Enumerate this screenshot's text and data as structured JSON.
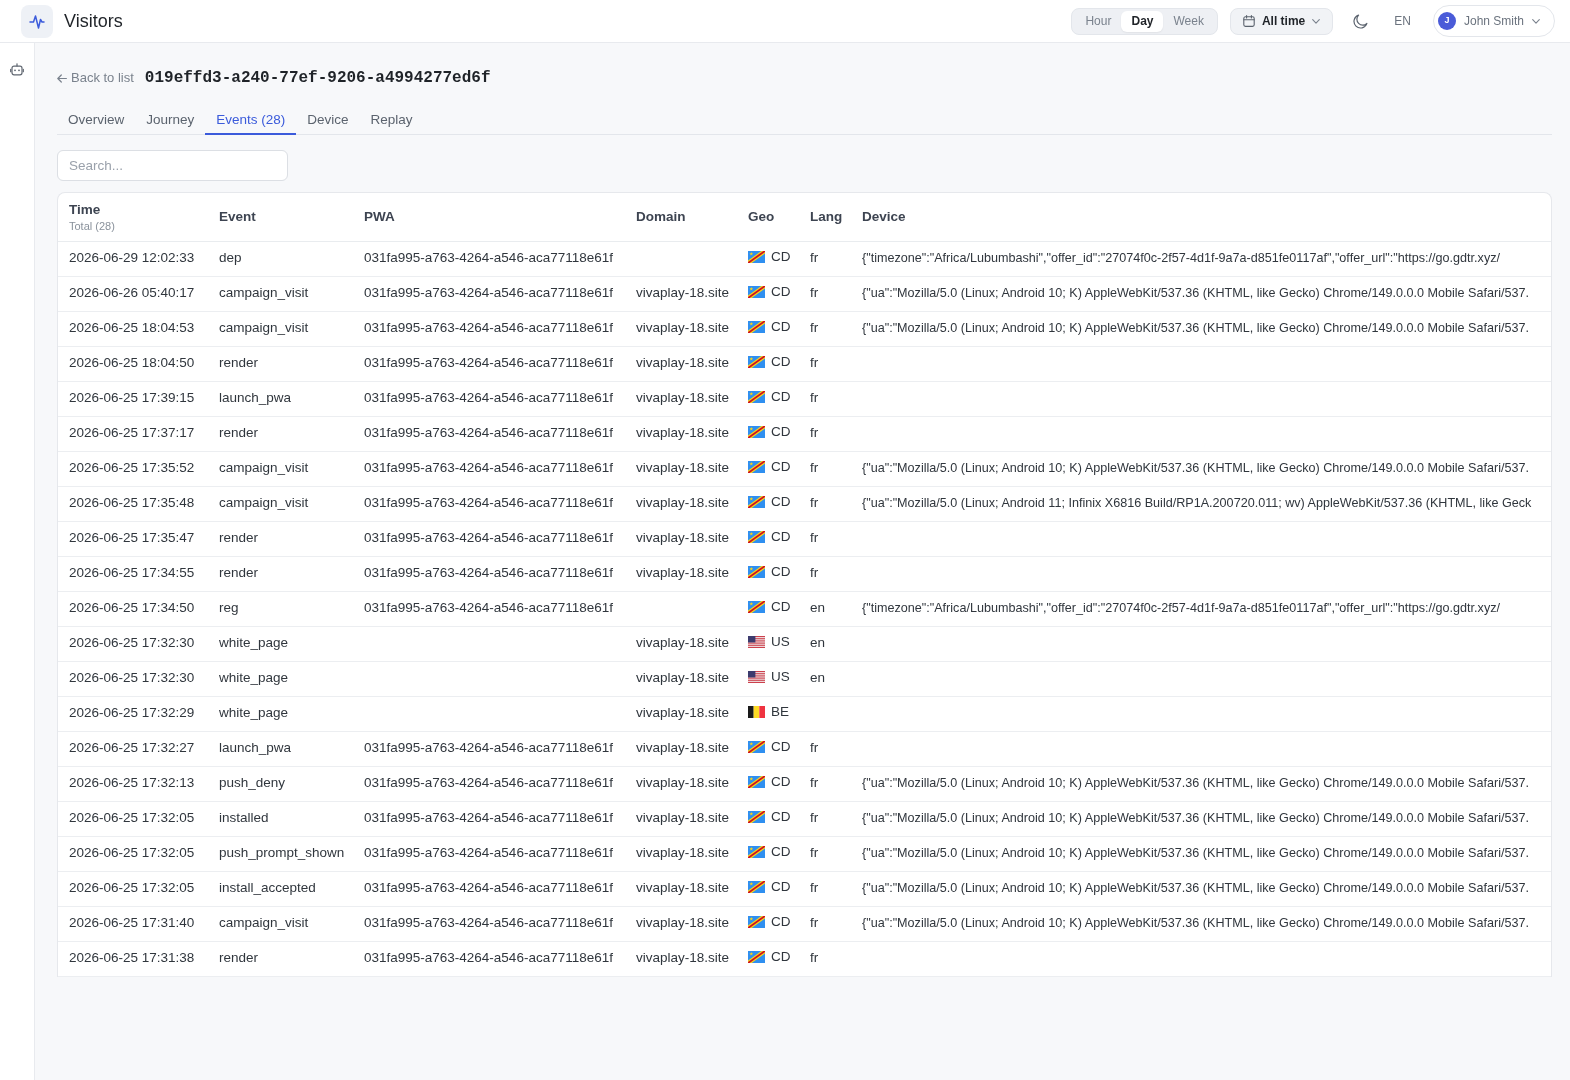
{
  "header": {
    "title": "Visitors",
    "periods": [
      {
        "label": "Hour",
        "selected": false
      },
      {
        "label": "Day",
        "selected": true
      },
      {
        "label": "Week",
        "selected": false
      }
    ],
    "date_range": "All time",
    "language": "EN",
    "user": {
      "initial": "J",
      "name": "John Smith"
    }
  },
  "visitor": {
    "back_link": "Back to list",
    "id": "019effd3-a240-77ef-9206-a4994277ed6f"
  },
  "tabs": [
    {
      "label": "Overview",
      "selected": false
    },
    {
      "label": "Journey",
      "selected": false
    },
    {
      "label": "Events (28)",
      "selected": true
    },
    {
      "label": "Device",
      "selected": false
    },
    {
      "label": "Replay",
      "selected": false
    }
  ],
  "search": {
    "placeholder": "Search..."
  },
  "table": {
    "columns": [
      "Time",
      "Event",
      "PWA",
      "Domain",
      "Geo",
      "Lang",
      "Device"
    ],
    "total": "Total (28)",
    "rows": [
      {
        "time": "2026-06-29 12:02:33",
        "event": "dep",
        "pwa": "031fa995-a763-4264-a546-aca77118e61f",
        "geo": {
          "kind": "cd",
          "code": "CD"
        },
        "lang": "fr",
        "device": "{\"timezone\":\"Africa/Lubumbashi\",\"offer_id\":\"27074f0c-2f57-4d1f-9a7a-d851fe0117af\",\"offer_url\":\"https://go.gdtr.xyz/"
      },
      {
        "time": "2026-06-26 05:40:17",
        "event": "campaign_visit",
        "pwa": "031fa995-a763-4264-a546-aca77118e61f",
        "domain": "vivaplay-18.site",
        "geo": {
          "kind": "cd",
          "code": "CD"
        },
        "lang": "fr",
        "device": "{\"ua\":\"Mozilla/5.0 (Linux; Android 10; K) AppleWebKit/537.36 (KHTML, like Gecko) Chrome/149.0.0.0 Mobile Safari/537."
      },
      {
        "time": "2026-06-25 18:04:53",
        "event": "campaign_visit",
        "pwa": "031fa995-a763-4264-a546-aca77118e61f",
        "domain": "vivaplay-18.site",
        "geo": {
          "kind": "cd",
          "code": "CD"
        },
        "lang": "fr",
        "device": "{\"ua\":\"Mozilla/5.0 (Linux; Android 10; K) AppleWebKit/537.36 (KHTML, like Gecko) Chrome/149.0.0.0 Mobile Safari/537."
      },
      {
        "time": "2026-06-25 18:04:50",
        "event": "render",
        "pwa": "031fa995-a763-4264-a546-aca77118e61f",
        "domain": "vivaplay-18.site",
        "geo": {
          "kind": "cd",
          "code": "CD"
        },
        "lang": "fr"
      },
      {
        "time": "2026-06-25 17:39:15",
        "event": "launch_pwa",
        "pwa": "031fa995-a763-4264-a546-aca77118e61f",
        "domain": "vivaplay-18.site",
        "geo": {
          "kind": "cd",
          "code": "CD"
        },
        "lang": "fr"
      },
      {
        "time": "2026-06-25 17:37:17",
        "event": "render",
        "pwa": "031fa995-a763-4264-a546-aca77118e61f",
        "domain": "vivaplay-18.site",
        "geo": {
          "kind": "cd",
          "code": "CD"
        },
        "lang": "fr"
      },
      {
        "time": "2026-06-25 17:35:52",
        "event": "campaign_visit",
        "pwa": "031fa995-a763-4264-a546-aca77118e61f",
        "domain": "vivaplay-18.site",
        "geo": {
          "kind": "cd",
          "code": "CD"
        },
        "lang": "fr",
        "device": "{\"ua\":\"Mozilla/5.0 (Linux; Android 10; K) AppleWebKit/537.36 (KHTML, like Gecko) Chrome/149.0.0.0 Mobile Safari/537."
      },
      {
        "time": "2026-06-25 17:35:48",
        "event": "campaign_visit",
        "pwa": "031fa995-a763-4264-a546-aca77118e61f",
        "domain": "vivaplay-18.site",
        "geo": {
          "kind": "cd",
          "code": "CD"
        },
        "lang": "fr",
        "device": "{\"ua\":\"Mozilla/5.0 (Linux; Android 11; Infinix X6816 Build/RP1A.200720.011; wv) AppleWebKit/537.36 (KHTML, like Geck"
      },
      {
        "time": "2026-06-25 17:35:47",
        "event": "render",
        "pwa": "031fa995-a763-4264-a546-aca77118e61f",
        "domain": "vivaplay-18.site",
        "geo": {
          "kind": "cd",
          "code": "CD"
        },
        "lang": "fr"
      },
      {
        "time": "2026-06-25 17:34:55",
        "event": "render",
        "pwa": "031fa995-a763-4264-a546-aca77118e61f",
        "domain": "vivaplay-18.site",
        "geo": {
          "kind": "cd",
          "code": "CD"
        },
        "lang": "fr"
      },
      {
        "time": "2026-06-25 17:34:50",
        "event": "reg",
        "pwa": "031fa995-a763-4264-a546-aca77118e61f",
        "geo": {
          "kind": "cd",
          "code": "CD"
        },
        "lang": "en",
        "device": "{\"timezone\":\"Africa/Lubumbashi\",\"offer_id\":\"27074f0c-2f57-4d1f-9a7a-d851fe0117af\",\"offer_url\":\"https://go.gdtr.xyz/"
      },
      {
        "time": "2026-06-25 17:32:30",
        "event": "white_page",
        "domain": "vivaplay-18.site",
        "geo": {
          "kind": "us",
          "code": "US"
        },
        "lang": "en"
      },
      {
        "time": "2026-06-25 17:32:30",
        "event": "white_page",
        "domain": "vivaplay-18.site",
        "geo": {
          "kind": "us",
          "code": "US"
        },
        "lang": "en"
      },
      {
        "time": "2026-06-25 17:32:29",
        "event": "white_page",
        "domain": "vivaplay-18.site",
        "geo": {
          "kind": "be",
          "code": "BE"
        }
      },
      {
        "time": "2026-06-25 17:32:27",
        "event": "launch_pwa",
        "pwa": "031fa995-a763-4264-a546-aca77118e61f",
        "domain": "vivaplay-18.site",
        "geo": {
          "kind": "cd",
          "code": "CD"
        },
        "lang": "fr"
      },
      {
        "time": "2026-06-25 17:32:13",
        "event": "push_deny",
        "pwa": "031fa995-a763-4264-a546-aca77118e61f",
        "domain": "vivaplay-18.site",
        "geo": {
          "kind": "cd",
          "code": "CD"
        },
        "lang": "fr",
        "device": "{\"ua\":\"Mozilla/5.0 (Linux; Android 10; K) AppleWebKit/537.36 (KHTML, like Gecko) Chrome/149.0.0.0 Mobile Safari/537."
      },
      {
        "time": "2026-06-25 17:32:05",
        "event": "installed",
        "pwa": "031fa995-a763-4264-a546-aca77118e61f",
        "domain": "vivaplay-18.site",
        "geo": {
          "kind": "cd",
          "code": "CD"
        },
        "lang": "fr",
        "device": "{\"ua\":\"Mozilla/5.0 (Linux; Android 10; K) AppleWebKit/537.36 (KHTML, like Gecko) Chrome/149.0.0.0 Mobile Safari/537."
      },
      {
        "time": "2026-06-25 17:32:05",
        "event": "push_prompt_shown",
        "pwa": "031fa995-a763-4264-a546-aca77118e61f",
        "domain": "vivaplay-18.site",
        "geo": {
          "kind": "cd",
          "code": "CD"
        },
        "lang": "fr",
        "device": "{\"ua\":\"Mozilla/5.0 (Linux; Android 10; K) AppleWebKit/537.36 (KHTML, like Gecko) Chrome/149.0.0.0 Mobile Safari/537."
      },
      {
        "time": "2026-06-25 17:32:05",
        "event": "install_accepted",
        "pwa": "031fa995-a763-4264-a546-aca77118e61f",
        "domain": "vivaplay-18.site",
        "geo": {
          "kind": "cd",
          "code": "CD"
        },
        "lang": "fr",
        "device": "{\"ua\":\"Mozilla/5.0 (Linux; Android 10; K) AppleWebKit/537.36 (KHTML, like Gecko) Chrome/149.0.0.0 Mobile Safari/537."
      },
      {
        "time": "2026-06-25 17:31:40",
        "event": "campaign_visit",
        "pwa": "031fa995-a763-4264-a546-aca77118e61f",
        "domain": "vivaplay-18.site",
        "geo": {
          "kind": "cd",
          "code": "CD"
        },
        "lang": "fr",
        "device": "{\"ua\":\"Mozilla/5.0 (Linux; Android 10; K) AppleWebKit/537.36 (KHTML, like Gecko) Chrome/149.0.0.0 Mobile Safari/537."
      },
      {
        "time": "2026-06-25 17:31:38",
        "event": "render",
        "pwa": "031fa995-a763-4264-a546-aca77118e61f",
        "domain": "vivaplay-18.site",
        "geo": {
          "kind": "cd",
          "code": "CD"
        },
        "lang": "fr"
      }
    ]
  }
}
